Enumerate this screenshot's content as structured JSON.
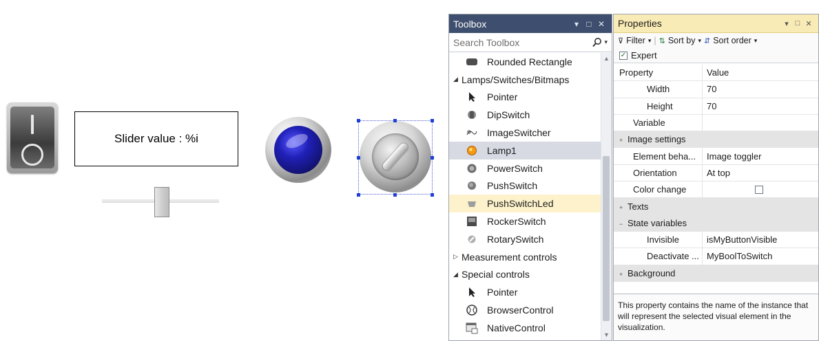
{
  "canvas": {
    "textbox_text": "Slider value : %i"
  },
  "toolbox": {
    "title": "Toolbox",
    "title_controls": [
      "▾",
      "□",
      "✕"
    ],
    "search_placeholder": "Search Toolbox",
    "items": [
      {
        "label": "Rounded Rectangle",
        "type": "item",
        "icon": "rounded-rectangle-icon"
      },
      {
        "label": "Lamps/Switches/Bitmaps",
        "type": "category",
        "expanded": true
      },
      {
        "label": "Pointer",
        "type": "item",
        "icon": "pointer-icon"
      },
      {
        "label": "DipSwitch",
        "type": "item",
        "icon": "dipswitch-icon"
      },
      {
        "label": "ImageSwitcher",
        "type": "item",
        "icon": "imageswitcher-icon"
      },
      {
        "label": "Lamp1",
        "type": "item",
        "icon": "lamp-icon",
        "state": "selected"
      },
      {
        "label": "PowerSwitch",
        "type": "item",
        "icon": "powerswitch-icon"
      },
      {
        "label": "PushSwitch",
        "type": "item",
        "icon": "pushswitch-icon"
      },
      {
        "label": "PushSwitchLed",
        "type": "item",
        "icon": "pushswitchled-icon",
        "state": "highlighted"
      },
      {
        "label": "RockerSwitch",
        "type": "item",
        "icon": "rockerswitch-icon"
      },
      {
        "label": "RotarySwitch",
        "type": "item",
        "icon": "rotaryswitch-icon"
      },
      {
        "label": "Measurement controls",
        "type": "category",
        "expanded": false
      },
      {
        "label": "Special controls",
        "type": "category",
        "expanded": true
      },
      {
        "label": "Pointer",
        "type": "item",
        "icon": "pointer-icon"
      },
      {
        "label": "BrowserControl",
        "type": "item",
        "icon": "browsercontrol-icon"
      },
      {
        "label": "NativeControl",
        "type": "item",
        "icon": "nativecontrol-icon"
      }
    ]
  },
  "properties": {
    "title": "Properties",
    "title_controls": [
      "▾",
      "□",
      "✕"
    ],
    "toolbar": {
      "filter_label": "Filter",
      "sort_by_label": "Sort by",
      "sort_order_label": "Sort order"
    },
    "expert_label": "Expert",
    "expert_checked": true,
    "header": {
      "property": "Property",
      "value": "Value"
    },
    "rows": [
      {
        "name": "Width",
        "value": "70",
        "indent": 2
      },
      {
        "name": "Height",
        "value": "70",
        "indent": 2
      },
      {
        "name": "Variable",
        "value": "",
        "indent": 1
      },
      {
        "name": "Image settings",
        "group": true,
        "expander": "+"
      },
      {
        "name": "Element beha...",
        "value": "Image toggler",
        "indent": 1
      },
      {
        "name": "Orientation",
        "value": "At top",
        "indent": 1
      },
      {
        "name": "Color change",
        "value": "",
        "checkbox": true,
        "indent": 1
      },
      {
        "name": "Texts",
        "group": true,
        "expander": "+"
      },
      {
        "name": "State variables",
        "group": true,
        "expander": "−"
      },
      {
        "name": "Invisible",
        "value": "isMyButtonVisible",
        "indent": 2
      },
      {
        "name": "Deactivate ...",
        "value": "MyBoolToSwitch",
        "indent": 2
      },
      {
        "name": "Background",
        "group": true,
        "expander": "+"
      }
    ],
    "description": "This property contains the name of the instance that will represent the selected visual element in the visualization."
  }
}
